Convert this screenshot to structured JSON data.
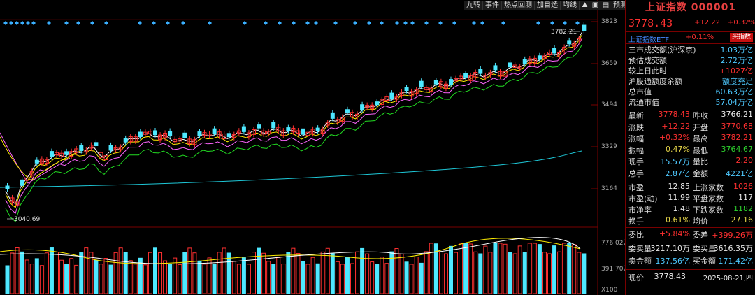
{
  "toolbar": {
    "items": [
      "九转",
      "事件",
      "热点回测",
      "加自选",
      "均线"
    ],
    "icons": [
      "mountain-icon",
      "gift-icon",
      "chart-icon",
      "prediction-icon",
      "close-icon",
      "expand-icon"
    ],
    "icon_label_pred": "预测"
  },
  "axis": {
    "price_ticks": [
      "3823",
      "3659",
      "3494",
      "3329",
      "3164"
    ],
    "vol_ticks": [
      "776.02万",
      "391.70万",
      "X100"
    ],
    "high_marker": "3782.21",
    "low_marker": "3040.69"
  },
  "panel": {
    "title": "上证指数 000001",
    "price": "3778.43",
    "change": "+12.22",
    "change_pct": "+0.32%",
    "etf_name": "上证指数ETF",
    "etf_pct": "+0.11%",
    "etf_button": "买指数",
    "rows1": [
      {
        "label": "三市成交额(沪深京)",
        "value": "1.03万亿",
        "color": "cyan"
      },
      {
        "label": "预估成交额",
        "value": "2.72万亿",
        "color": "cyan"
      },
      {
        "label": "较上日此时",
        "value": "+1027亿",
        "color": "red"
      },
      {
        "label": "沪股通额度余额",
        "value": "额度充足",
        "color": "cyan"
      },
      {
        "label": "总市值",
        "value": "60.63万亿",
        "color": "cyan"
      },
      {
        "label": "流通市值",
        "value": "57.04万亿",
        "color": "cyan"
      }
    ],
    "rows2": [
      {
        "l1": "最新",
        "v1": "3778.43",
        "c1": "red",
        "l2": "昨收",
        "v2": "3766.21",
        "c2": "white"
      },
      {
        "l1": "涨跌",
        "v1": "+12.22",
        "c1": "red",
        "l2": "开盘",
        "v2": "3770.68",
        "c2": "red"
      },
      {
        "l1": "涨幅",
        "v1": "+0.32%",
        "c1": "red",
        "l2": "最高",
        "v2": "3782.21",
        "c2": "red"
      },
      {
        "l1": "振幅",
        "v1": "0.47%",
        "c1": "yellow",
        "l2": "最低",
        "v2": "3764.67",
        "c2": "green"
      },
      {
        "l1": "现手",
        "v1": "15.57万",
        "c1": "cyan",
        "l2": "量比",
        "v2": "2.20",
        "c2": "red"
      },
      {
        "l1": "总手",
        "v1": "2.87亿",
        "c1": "cyan",
        "l2": "金额",
        "v2": "4221亿",
        "c2": "cyan"
      }
    ],
    "rows3": [
      {
        "l1": "市盈",
        "v1": "12.85",
        "c1": "white",
        "l2": "上涨家数",
        "v2": "1026",
        "c2": "red"
      },
      {
        "l1": "市盈(动)",
        "v1": "11.99",
        "c1": "white",
        "l2": "平盘家数",
        "v2": "117",
        "c2": "white"
      },
      {
        "l1": "市净率",
        "v1": "1.48",
        "c1": "white",
        "l2": "下跌家数",
        "v2": "1182",
        "c2": "green"
      },
      {
        "l1": "换手",
        "v1": "0.61%",
        "c1": "yellow",
        "l2": "均价",
        "v2": "27.16",
        "c2": "yellow"
      }
    ],
    "rows4": [
      {
        "l1": "委比",
        "v1": "+5.84%",
        "c1": "red",
        "l2": "委差",
        "v2": "+399.26万",
        "c2": "red"
      },
      {
        "l1": "委卖量",
        "v1": "3217.10万",
        "c1": "white",
        "l2": "委买量",
        "v2": "3616.35万",
        "c2": "white"
      },
      {
        "l1": "卖金额",
        "v1": "137.56亿",
        "c1": "cyan",
        "l2": "买金额",
        "v2": "171.42亿",
        "c2": "cyan"
      }
    ],
    "footer": {
      "label": "现价",
      "value": "3778.43",
      "date": "2025-08-21,四"
    }
  },
  "colors": {
    "up": "#ff3030",
    "down": "#4ee8ff",
    "ma5": "#ffffff",
    "ma10": "#ffee00",
    "ma20": "#ff66ff",
    "ma60": "#22dd22",
    "ma250": "#1ec8d8"
  }
}
